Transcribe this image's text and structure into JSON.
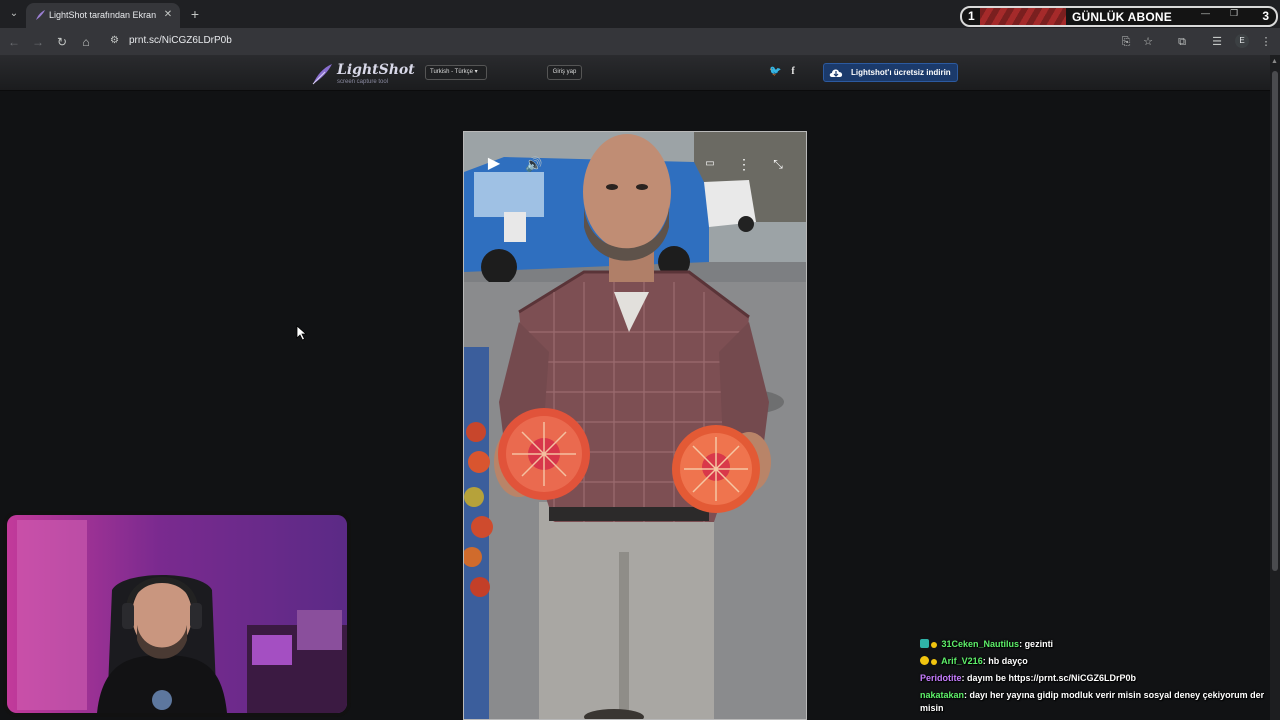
{
  "browser": {
    "tab": {
      "title": "LightShot tarafından Ekran Görüntüsü",
      "favicon": "lightshot-feather-icon"
    },
    "url": "prnt.sc/NiCGZ6LDrP0b",
    "profile_initial": "E"
  },
  "overlay": {
    "left_count": "1",
    "label": "GÜNLÜK ABONE",
    "right_count": "3"
  },
  "lightshot": {
    "logo_text": "LightShot",
    "logo_sub": "screen capture tool",
    "language": "Turkish - Türkçe",
    "login": "Giriş yap",
    "social": [
      "twitter-icon",
      "facebook-icon"
    ],
    "download": "Lightshot'ı ücretsiz indirin"
  },
  "chat": [
    {
      "user": "31Ceken_Nautilus",
      "color": "#5ef06a",
      "badges": [
        "#2fb3a8",
        "#f1c40f"
      ],
      "message": "gezinti"
    },
    {
      "user": "Arif_V216",
      "color": "#5ef06a",
      "badges": [
        "#f1c40f",
        "#f1c40f"
      ],
      "message": "hb dayço"
    },
    {
      "user": "Peridotite",
      "color": "#c77dff",
      "badges": [],
      "message": "dayım be https://prnt.sc/NiCGZ6LDrP0b"
    },
    {
      "user": "nakatakan",
      "color": "#5ef06a",
      "badges": [],
      "message": "dayı her yayına gidip modluk verir misin sosyal deney çekiyorum der misin"
    }
  ],
  "colors": {
    "accent_blue": "#1b3a6b",
    "overlay_red": "#a52a2a",
    "page_bg": "#111214"
  }
}
